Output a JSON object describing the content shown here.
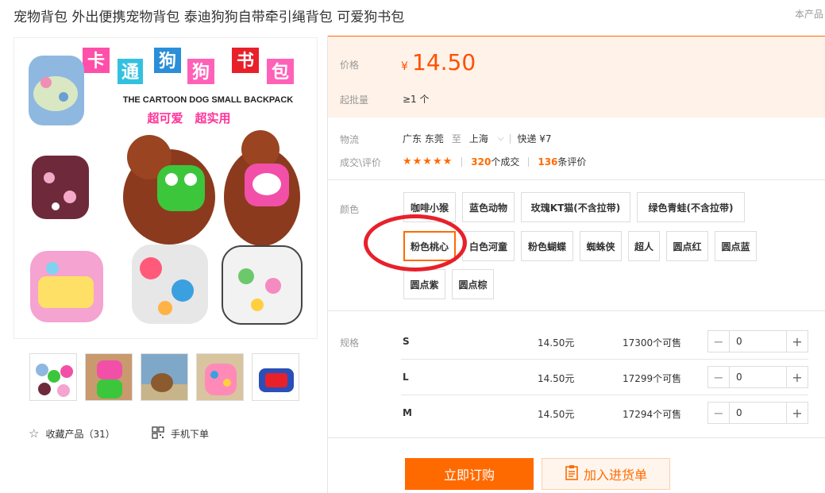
{
  "product": {
    "title": "宠物背包 外出便携宠物背包 泰迪狗狗自带牵引绳背包 可爱狗书包",
    "title_right": "本产品"
  },
  "gallery": {
    "banner_chars": [
      "卡",
      "通",
      "狗",
      "狗",
      "书",
      "包"
    ],
    "banner_en": "THE CARTOON DOG SMALL BACKPACK",
    "banner_sub": "超可爱　超实用",
    "favorite_label": "收藏产品（31）",
    "mobile_label": "手机下单"
  },
  "price_panel": {
    "price_label": "价格",
    "currency": "¥",
    "price": "14.50",
    "min_label": "起批量",
    "min_value": "≥1 个"
  },
  "logistics": {
    "label": "物流",
    "from": "广东 东莞",
    "to_word": "至",
    "to": "上海",
    "express": "快递 ¥7"
  },
  "deals": {
    "label": "成交\\评价",
    "stars": "★★★★★",
    "deal_count": "320",
    "deal_suffix": "个成交",
    "review_count": "136",
    "review_suffix": "条评价"
  },
  "colors": {
    "label": "颜色",
    "options": [
      "咖啡小猴",
      "蓝色动物",
      "玫瑰KT猫(不含拉带)",
      "绿色青蛙(不含拉带)",
      "粉色桃心",
      "白色河童",
      "粉色蝴蝶",
      "蜘蛛侠",
      "超人",
      "圆点红",
      "圆点蓝",
      "圆点紫",
      "圆点棕"
    ],
    "selected": "粉色桃心"
  },
  "specs": {
    "label": "规格",
    "rows": [
      {
        "name": "S",
        "price": "14.50元",
        "stock": "17300个可售",
        "qty": "0"
      },
      {
        "name": "L",
        "price": "14.50元",
        "stock": "17299个可售",
        "qty": "0"
      },
      {
        "name": "M",
        "price": "14.50元",
        "stock": "17294个可售",
        "qty": "0"
      }
    ]
  },
  "actions": {
    "buy_label": "立即订购",
    "cart_label": "加入进货单"
  },
  "colors_theme": {
    "accent": "#ff6a00",
    "price": "#ff5000",
    "highlight_circle": "#e8202a"
  }
}
